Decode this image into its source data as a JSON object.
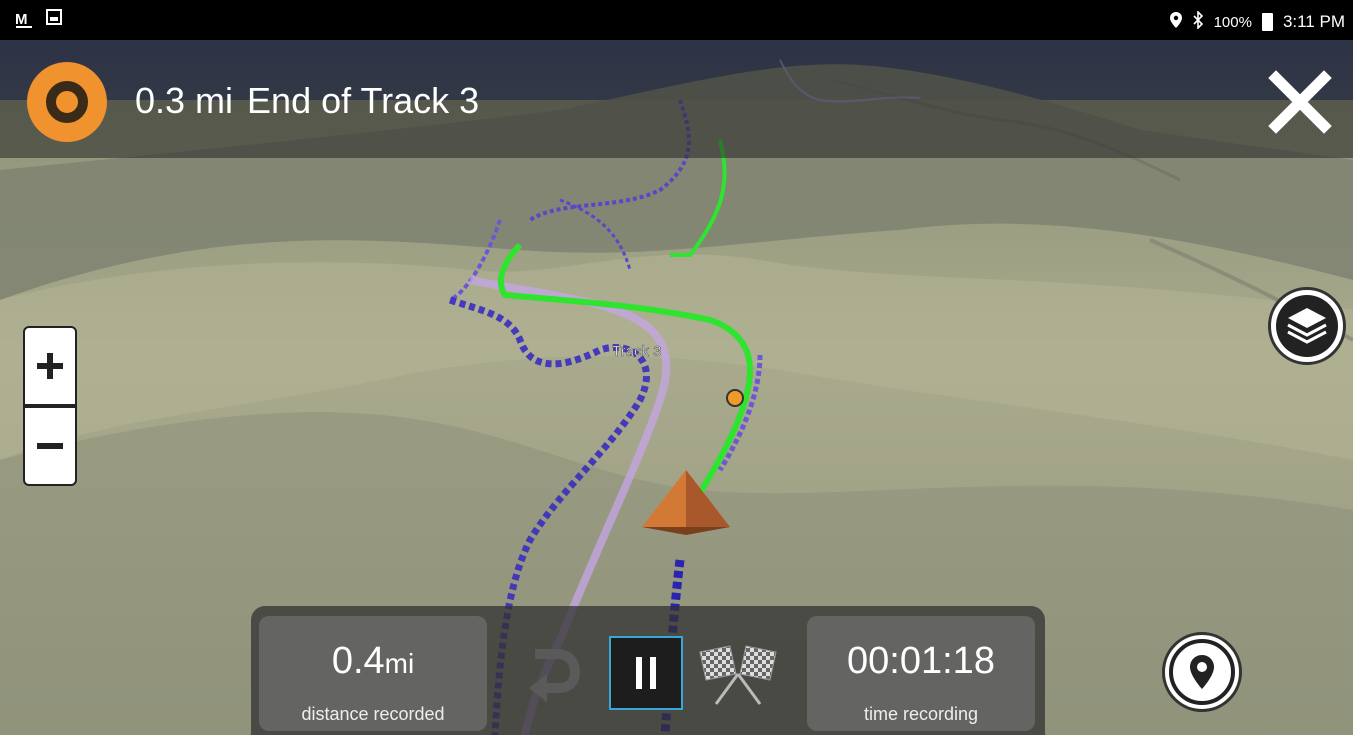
{
  "status_bar": {
    "left_icons": [
      "notification-m-icon",
      "image-icon"
    ],
    "battery_text": "100%",
    "time": "3:11 PM",
    "right_icons": [
      "location-pin-icon",
      "bluetooth-icon",
      "battery-icon"
    ]
  },
  "navigation": {
    "distance": "0.3 mi",
    "destination": "End of Track 3",
    "accent_color": "#f0922e"
  },
  "map": {
    "track_label": "Track 3"
  },
  "recording": {
    "distance_value": "0.4",
    "distance_unit": "mi",
    "distance_label": "distance recorded",
    "time_value": "00:01:18",
    "time_label": "time recording",
    "pause_accent": "#35a7d8"
  },
  "controls": {
    "zoom_in_label": "+",
    "zoom_out_label": "−"
  }
}
